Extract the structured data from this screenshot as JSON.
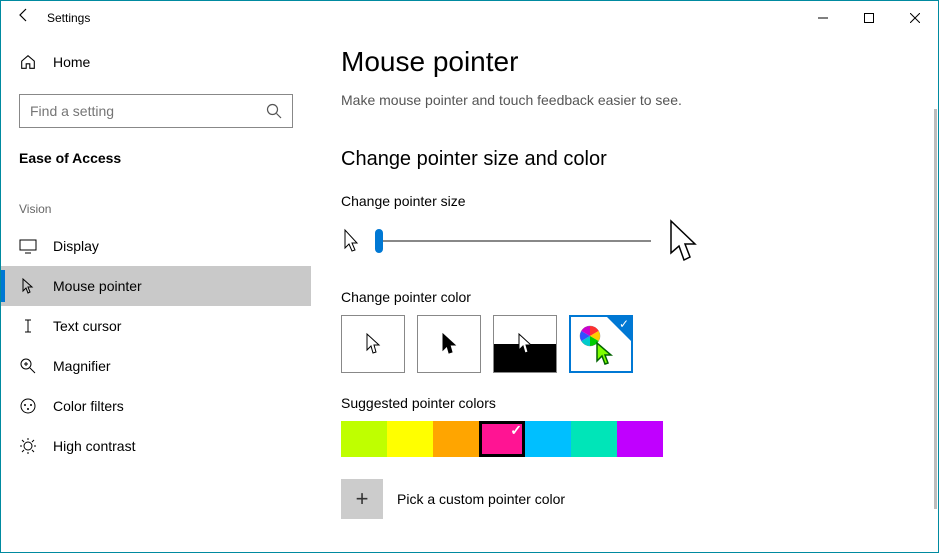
{
  "window": {
    "title": "Settings"
  },
  "sidebar": {
    "home": "Home",
    "search_placeholder": "Find a setting",
    "section": "Ease of Access",
    "group": "Vision",
    "items": [
      {
        "label": "Display"
      },
      {
        "label": "Mouse pointer"
      },
      {
        "label": "Text cursor"
      },
      {
        "label": "Magnifier"
      },
      {
        "label": "Color filters"
      },
      {
        "label": "High contrast"
      }
    ]
  },
  "page": {
    "title": "Mouse pointer",
    "subtitle": "Make mouse pointer and touch feedback easier to see.",
    "section_heading": "Change pointer size and color",
    "size_label": "Change pointer size",
    "color_label": "Change pointer color",
    "suggested_label": "Suggested pointer colors",
    "suggested_colors": [
      "#BFFF00",
      "#FFFF00",
      "#FFA500",
      "#FF1493",
      "#00BFFF",
      "#00E5B8",
      "#C000FF"
    ],
    "selected_color_index": 3,
    "custom_label": "Pick a custom pointer color"
  }
}
